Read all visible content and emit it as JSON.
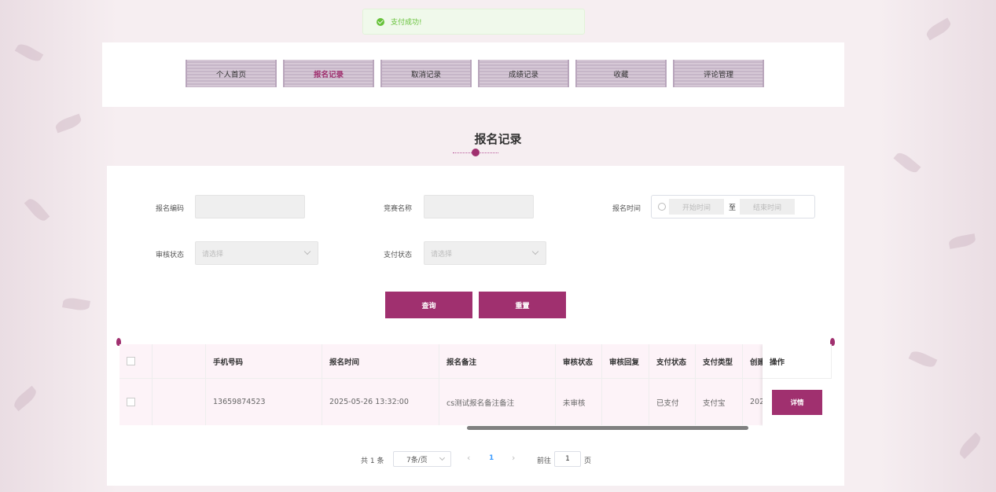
{
  "toast": {
    "text": "支付成功!",
    "color": "#67c23a"
  },
  "nav": {
    "items": [
      "个人首页",
      "报名记录",
      "取消记录",
      "成绩记录",
      "收藏",
      "评论管理"
    ],
    "active": "报名记录"
  },
  "page": {
    "title": "报名记录"
  },
  "search": {
    "code_label": "报名编码",
    "name_label": "竞赛名称",
    "time_label": "报名时间",
    "start_placeholder": "开始时间",
    "range_separator": "至",
    "end_placeholder": "结束时间",
    "audit_label": "审核状态",
    "audit_placeholder": "请选择",
    "pay_label": "支付状态",
    "pay_placeholder": "请选择",
    "query_button": "查询",
    "reset_button": "重置"
  },
  "table": {
    "headers": [
      "",
      "",
      "手机号码",
      "报名时间",
      "报名备注",
      "审核状态",
      "审核回复",
      "支付状态",
      "支付类型",
      "创建",
      "操作"
    ],
    "rows": [
      {
        "phone": "13659874523",
        "time": "2025-05-26 13:32:00",
        "remark": "cs测试报名备注备注",
        "audit": "未审核",
        "reply": "",
        "pay_status": "已支付",
        "pay_type": "支付宝",
        "created": "202",
        "action": "详情"
      }
    ]
  },
  "pagination": {
    "total_text": "共 1 条",
    "page_size": "7条/页",
    "prev": "‹",
    "current_page": "1",
    "next": "›",
    "goto_label": "前往",
    "goto_value": "1",
    "page_unit": "页"
  },
  "colors": {
    "primary": "#a0306f",
    "background": "#f6eef1"
  }
}
